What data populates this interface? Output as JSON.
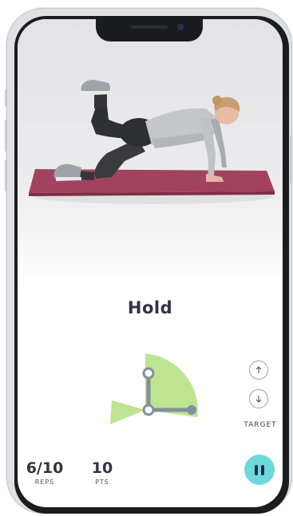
{
  "exercise": {
    "instruction": "Hold"
  },
  "gauge": {
    "sector_color": "#bfe491",
    "joint_color": "#828f9c"
  },
  "target": {
    "label": "TARGET",
    "up_icon": "arrow-up-icon",
    "down_icon": "arrow-down-icon"
  },
  "stats": {
    "reps": {
      "value": "6/10",
      "label": "REPS"
    },
    "points": {
      "value": "10",
      "label": "PTS"
    }
  },
  "controls": {
    "pause_icon": "pause-icon",
    "pause_color": "#6fd8dc"
  },
  "photo": {
    "mat_color": "#a3425e"
  }
}
